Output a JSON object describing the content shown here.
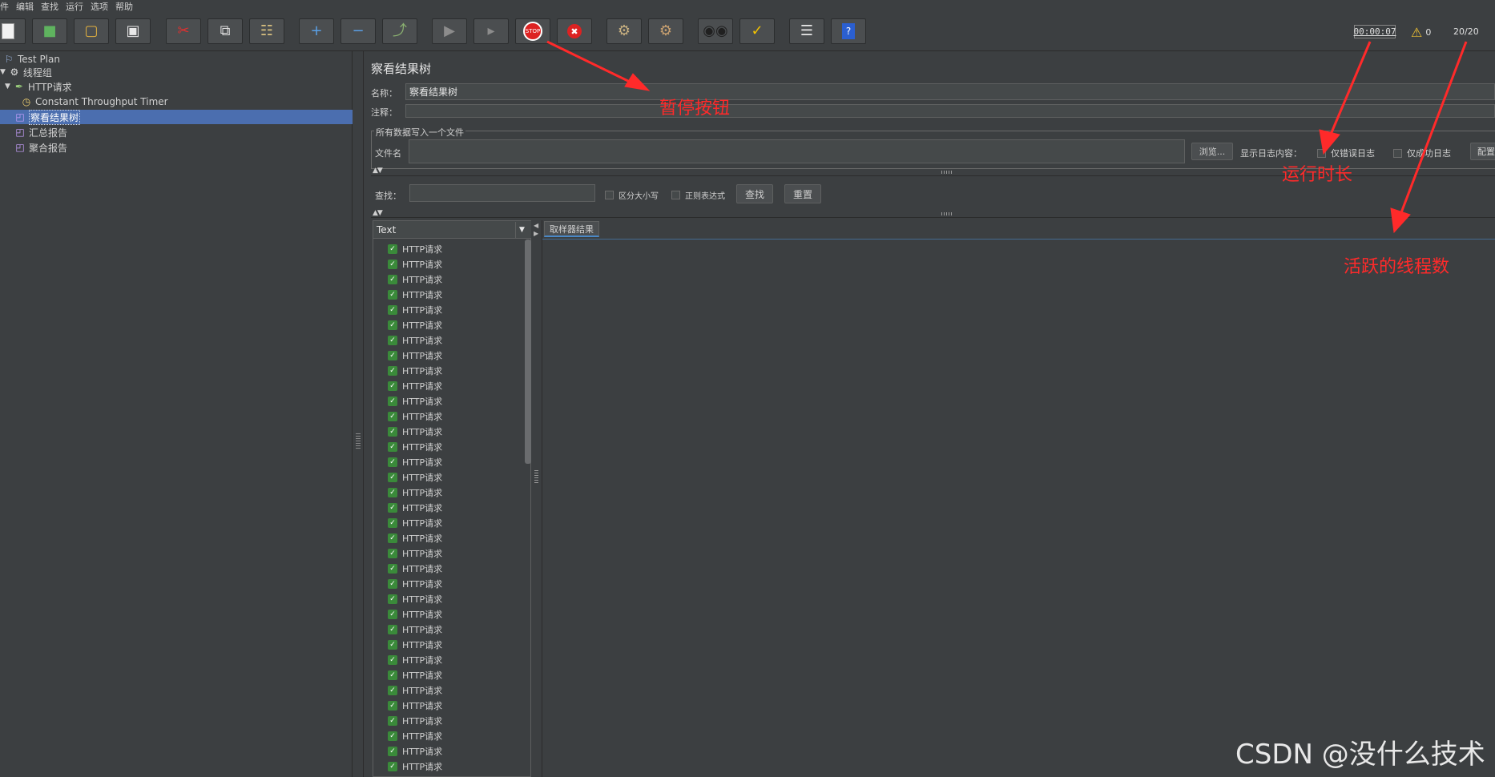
{
  "menu": [
    "件",
    "编辑",
    "查找",
    "运行",
    "选项",
    "帮助"
  ],
  "toolbar": {
    "icons": [
      "new-icon",
      "templates-icon",
      "open-icon",
      "save-icon",
      "cut-icon",
      "copy-icon",
      "paste-icon",
      "expand-icon",
      "collapse-icon",
      "toggle-icon",
      "start-icon",
      "start-no-pause-icon",
      "stop-icon",
      "shutdown-icon",
      "clear-icon",
      "clear-all-icon",
      "search-icon",
      "reset-search-icon",
      "function-helper-icon",
      "help-icon"
    ],
    "stop_label": "STOP"
  },
  "status": {
    "elapsed": "00:00:07",
    "warnings": "0",
    "threads": "20/20"
  },
  "tree": {
    "nodes": [
      {
        "label": "Test Plan",
        "icon": "test-plan-icon"
      },
      {
        "label": "线程组",
        "icon": "thread-group-icon"
      },
      {
        "label": "HTTP请求",
        "icon": "http-sampler-icon"
      },
      {
        "label": "Constant Throughput Timer",
        "icon": "timer-icon"
      },
      {
        "label": "察看结果树",
        "icon": "listener-icon",
        "selected": true
      },
      {
        "label": "汇总报告",
        "icon": "listener-icon"
      },
      {
        "label": "聚合报告",
        "icon": "listener-icon"
      }
    ]
  },
  "panel": {
    "title": "察看结果树",
    "name_label": "名称：",
    "name_value": "察看结果树",
    "comment_label": "注释：",
    "comment_value": "",
    "file_group_title": "所有数据写入一个文件",
    "filename_label": "文件名",
    "filename_value": "",
    "browse_label": "浏览...",
    "log_label": "显示日志内容：",
    "errors_only_label": "仅错误日志",
    "success_only_label": "仅成功日志",
    "configure_label": "配置"
  },
  "search": {
    "label": "查找：",
    "value": "",
    "case_label": "区分大小写",
    "regex_label": "正则表达式",
    "find_label": "查找",
    "reset_label": "重置"
  },
  "results": {
    "renderer": "Text",
    "items": [
      "HTTP请求",
      "HTTP请求",
      "HTTP请求",
      "HTTP请求",
      "HTTP请求",
      "HTTP请求",
      "HTTP请求",
      "HTTP请求",
      "HTTP请求",
      "HTTP请求",
      "HTTP请求",
      "HTTP请求",
      "HTTP请求",
      "HTTP请求",
      "HTTP请求",
      "HTTP请求",
      "HTTP请求",
      "HTTP请求",
      "HTTP请求",
      "HTTP请求",
      "HTTP请求",
      "HTTP请求",
      "HTTP请求",
      "HTTP请求",
      "HTTP请求",
      "HTTP请求",
      "HTTP请求",
      "HTTP请求",
      "HTTP请求",
      "HTTP请求",
      "HTTP请求",
      "HTTP请求",
      "HTTP请求",
      "HTTP请求",
      "HTTP请求"
    ],
    "tab_label": "取样器结果"
  },
  "annotations": {
    "pause": "暂停按钮",
    "duration": "运行时长",
    "threads": "活跃的线程数",
    "color": "#ff2a2a"
  },
  "watermark": "CSDN @没什么技术"
}
